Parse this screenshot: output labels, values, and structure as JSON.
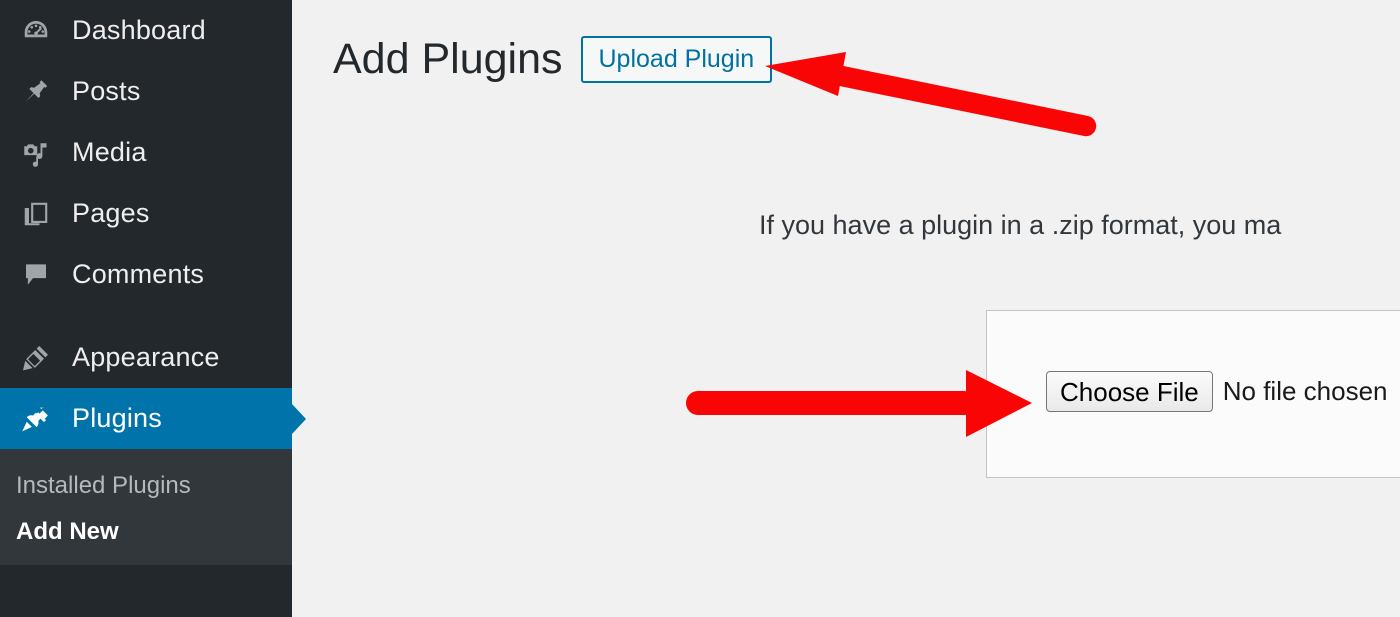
{
  "sidebar": {
    "items": [
      {
        "label": "Dashboard",
        "icon": "dashboard-gauge-icon",
        "current": false
      },
      {
        "label": "Posts",
        "icon": "pin-icon",
        "current": false
      },
      {
        "label": "Media",
        "icon": "camera-music-icon",
        "current": false
      },
      {
        "label": "Pages",
        "icon": "pages-icon",
        "current": false
      },
      {
        "label": "Comments",
        "icon": "comment-bubble-icon",
        "current": false
      },
      {
        "label": "Appearance",
        "icon": "paintbrush-icon",
        "current": false
      },
      {
        "label": "Plugins",
        "icon": "plug-icon",
        "current": true
      }
    ],
    "submenu": [
      {
        "label": "Installed Plugins",
        "current": false
      },
      {
        "label": "Add New",
        "current": true
      }
    ],
    "colors": {
      "background": "#23282d",
      "submenu_background": "#32373c",
      "current_highlight": "#0073aa",
      "icon": "#a0a5aa",
      "text": "#eeeeee",
      "submenu_text": "#b4b9be"
    }
  },
  "main": {
    "page_title": "Add Plugins",
    "upload_plugin_button": "Upload Plugin",
    "upload_description": "If you have a plugin in a .zip format, you ma",
    "upload_panel": {
      "choose_file_button": "Choose File",
      "no_file_text": "No file chosen"
    },
    "colors": {
      "background": "#f1f1f1",
      "title": "#23282d",
      "link_blue": "#0071a1",
      "panel_background": "#fbfbfb",
      "panel_border": "#c3c4c7"
    }
  },
  "annotations": {
    "arrow_color": "#fa0505",
    "arrows": [
      {
        "name": "arrow-pointing-to-upload-plugin",
        "direction": "up-left",
        "target": "Upload Plugin"
      },
      {
        "name": "arrow-pointing-to-choose-file",
        "direction": "right",
        "target": "Choose File"
      }
    ]
  }
}
